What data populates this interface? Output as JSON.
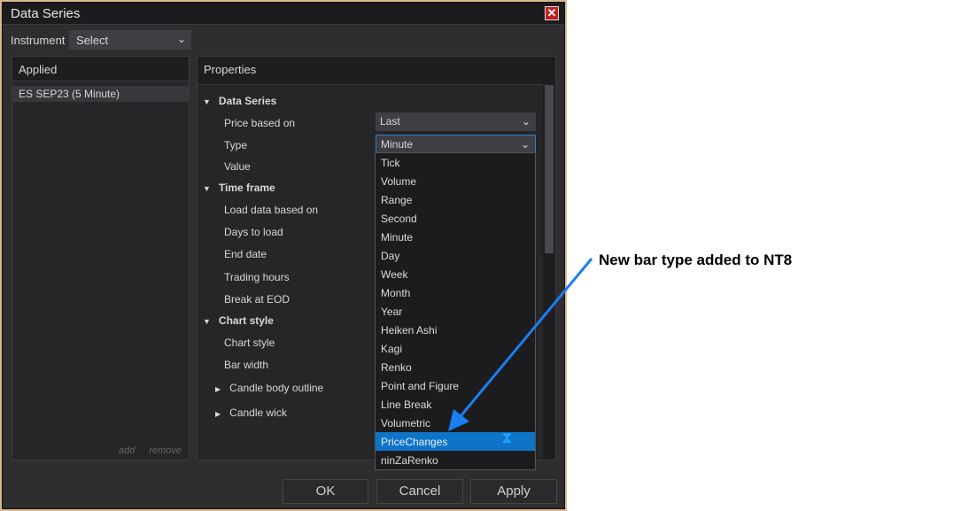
{
  "dialog": {
    "title": "Data Series"
  },
  "instrument": {
    "label": "Instrument",
    "value": "Select"
  },
  "applied": {
    "header": "Applied",
    "items": [
      "ES SEP23 (5 Minute)"
    ],
    "add_label": "add",
    "remove_label": "remove"
  },
  "properties": {
    "header": "Properties",
    "data_series": {
      "label": "Data Series",
      "price_based_on": "Price based on",
      "price_value": "Last",
      "type": "Type",
      "type_value": "Minute",
      "value": "Value"
    },
    "time_frame": {
      "label": "Time frame",
      "load_data": "Load data based on",
      "days": "Days to load",
      "end_date": "End date",
      "trading_hours": "Trading hours",
      "break_eod": "Break at EOD"
    },
    "chart_style": {
      "label": "Chart style",
      "chart_style": "Chart style",
      "bar_width": "Bar width",
      "candle_body": "Candle body outline",
      "candle_wick": "Candle wick"
    }
  },
  "type_options": [
    "Tick",
    "Volume",
    "Range",
    "Second",
    "Minute",
    "Day",
    "Week",
    "Month",
    "Year",
    "Heiken Ashi",
    "Kagi",
    "Renko",
    "Point and Figure",
    "Line Break",
    "Volumetric",
    "PriceChanges",
    "ninZaRenko"
  ],
  "selected_option": "PriceChanges",
  "buttons": {
    "ok": "OK",
    "cancel": "Cancel",
    "apply": "Apply"
  },
  "annotation": "New bar type added to NT8",
  "colors": {
    "accent": "#0d74c8",
    "arrow": "#1a7ff0",
    "close": "#c02020"
  }
}
